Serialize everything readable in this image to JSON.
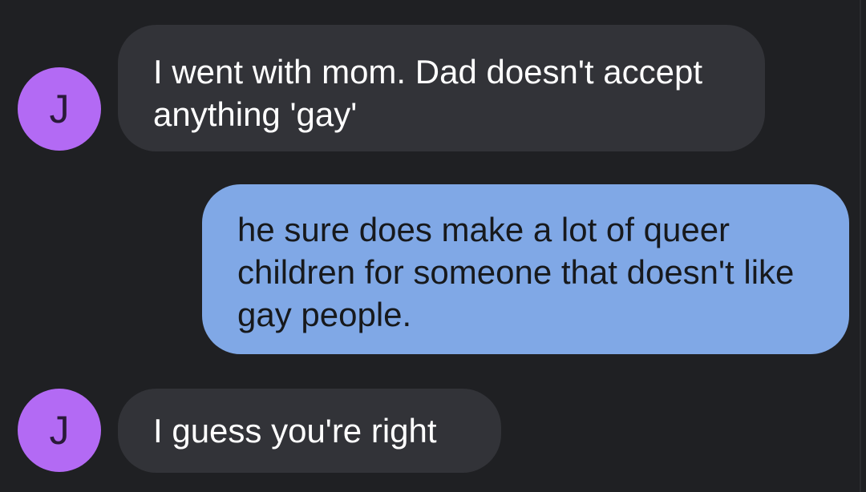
{
  "conversation": {
    "messages": [
      {
        "sender": "incoming",
        "avatar_initial": "J",
        "text": "I went with mom. Dad doesn't accept anything 'gay'"
      },
      {
        "sender": "outgoing",
        "text": "he sure does make a lot of queer children for someone that doesn't like gay people."
      },
      {
        "sender": "incoming",
        "avatar_initial": "J",
        "text": "I guess you're right"
      }
    ]
  },
  "colors": {
    "background": "#1f2023",
    "incoming_bubble": "#323338",
    "outgoing_bubble": "#80a8e6",
    "avatar": "#b36af4"
  }
}
